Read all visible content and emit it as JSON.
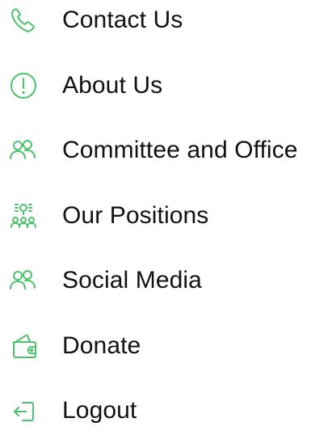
{
  "menu": {
    "accent_color": "#4cc36b",
    "text_color": "#111111",
    "items": [
      {
        "label": "Contact Us",
        "icon": "phone-icon"
      },
      {
        "label": "About Us",
        "icon": "info-circle-icon"
      },
      {
        "label": "Committee and Office",
        "icon": "users-icon"
      },
      {
        "label": "Our Positions",
        "icon": "group-idea-icon"
      },
      {
        "label": "Social Media",
        "icon": "users-icon"
      },
      {
        "label": "Donate",
        "icon": "wallet-icon"
      },
      {
        "label": "Logout",
        "icon": "logout-icon"
      }
    ]
  }
}
